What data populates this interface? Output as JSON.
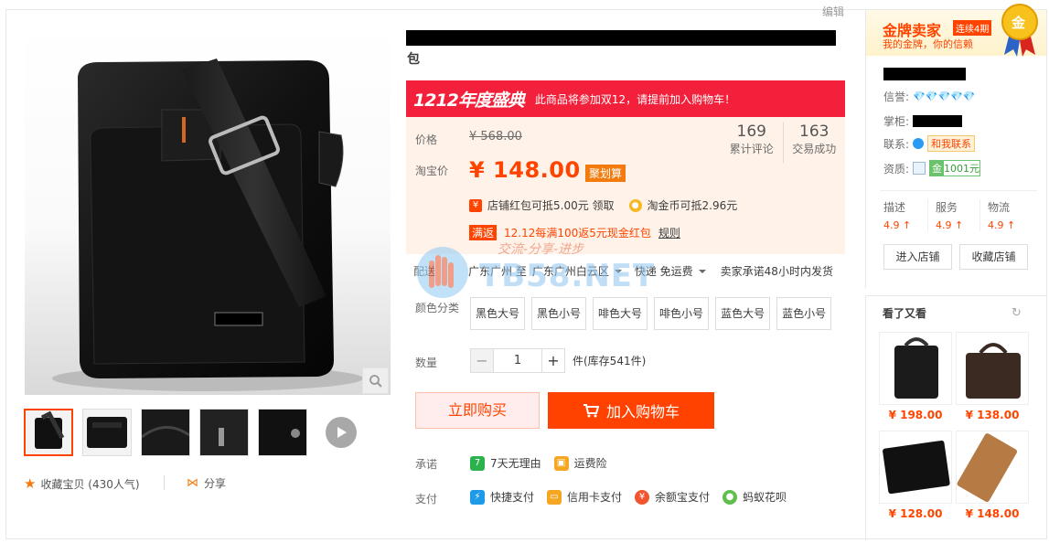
{
  "toolbar": {
    "edit": "编辑"
  },
  "gallery": {
    "collect_label": "收藏宝贝 (430人气)",
    "share_label": "分享"
  },
  "product": {
    "title_suffix": "包",
    "banner_logo": "1212年度盛典",
    "banner_text": "此商品将参加双12，请提前加入购物车！",
    "price_label": "价格",
    "original_price": "¥ 568.00",
    "taobao_price_label": "淘宝价",
    "taobao_price": "¥ 148.00",
    "price_tag": "聚划算",
    "stats": [
      {
        "num": "169",
        "label": "累计评论"
      },
      {
        "num": "163",
        "label": "交易成功"
      }
    ],
    "coupon_icon": "¥",
    "coupon_text": "店铺红包可抵5.00元 领取",
    "coin_text": "淘金币可抵2.96元",
    "promo_tag": "满返",
    "promo_text": "12.12每满100返5元现金红包",
    "promo_rule": "规则",
    "delivery_label": "配送",
    "delivery_from": "广东广州 至",
    "delivery_to": "广东广州白云区",
    "delivery_method": "快递 免运费",
    "delivery_promise": "卖家承诺48小时内发货",
    "sku_label": "颜色分类",
    "skus": [
      "黑色大号",
      "黑色小号",
      "啡色大号",
      "啡色小号",
      "蓝色大号",
      "蓝色小号"
    ],
    "qty_label": "数量",
    "qty_value": "1",
    "qty_minus": "−",
    "qty_plus": "+",
    "stock_text": "件(库存541件)",
    "buy_now": "立即购买",
    "add_cart": "加入购物车",
    "promise_label": "承诺",
    "promises": [
      "7天无理由",
      "运费险"
    ],
    "pay_label": "支付",
    "payments": [
      "快捷支付",
      "信用卡支付",
      "余额宝支付",
      "蚂蚁花呗"
    ]
  },
  "watermark": {
    "text1": "交流-分享-进步",
    "text2": "TB58.NET"
  },
  "seller": {
    "gold_title": "金牌卖家",
    "gold_badge": "连续4期",
    "gold_sub": "我的金牌，你的信赖",
    "medal_char": "金",
    "reputation_label": "信誉:",
    "diamonds": "💎💎💎💎💎",
    "keeper_label": "掌柜:",
    "contact_label": "联系:",
    "contact_btn": "和我联系",
    "qual_label": "资质:",
    "deposit_icon": "金",
    "deposit": "1001元",
    "dsr": [
      {
        "t": "描述",
        "v": "4.9 ↑"
      },
      {
        "t": "服务",
        "v": "4.9 ↑"
      },
      {
        "t": "物流",
        "v": "4.9 ↑"
      }
    ],
    "enter_shop": "进入店铺",
    "collect_shop": "收藏店铺"
  },
  "also_viewed": {
    "title": "看了又看",
    "items": [
      {
        "price": "¥ 198.00"
      },
      {
        "price": "¥ 138.00"
      },
      {
        "price": "¥ 128.00"
      },
      {
        "price": "¥ 148.00"
      }
    ]
  },
  "colors": {
    "accent": "#ff4400",
    "price_bg": "#fff2e8",
    "banner": "#f2203a"
  }
}
